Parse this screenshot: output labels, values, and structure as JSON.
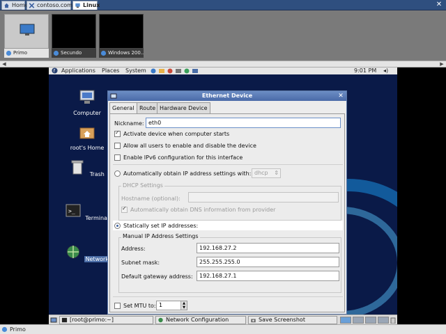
{
  "tabs": [
    {
      "label": "Home",
      "icon": "home-icon"
    },
    {
      "label": "contoso.com",
      "icon": "network-icon"
    },
    {
      "label": "Linux",
      "icon": "vm-icon",
      "active": true
    }
  ],
  "thumbnails": [
    {
      "label": "Primo",
      "active": true
    },
    {
      "label": "Secundo"
    },
    {
      "label": "Windows 200..."
    }
  ],
  "gnome_panel": {
    "menus": [
      "Applications",
      "Places",
      "System"
    ],
    "clock": "9:01 PM"
  },
  "desktop_icons": [
    {
      "label": "Computer",
      "icon": "computer-icon"
    },
    {
      "label": "root's Home",
      "icon": "home-folder-icon"
    },
    {
      "label": "Trash",
      "icon": "trash-icon"
    },
    {
      "label": "Terminal",
      "icon": "terminal-icon"
    },
    {
      "label": "Network",
      "icon": "network-config-icon",
      "selected": true
    }
  ],
  "dialog": {
    "title": "Ethernet Device",
    "tabs": [
      "General",
      "Route",
      "Hardware Device"
    ],
    "nickname_label": "Nickname:",
    "nickname_value": "eth0",
    "activate_label": "Activate device when computer starts",
    "activate_checked": true,
    "allow_users_label": "Allow all users to enable and disable the device",
    "allow_users_checked": false,
    "ipv6_label": "Enable IPv6 configuration for this interface",
    "ipv6_checked": false,
    "auto_label": "Automatically obtain IP address settings with:",
    "auto_method": "dhcp",
    "dhcp_settings_label": "DHCP Settings",
    "hostname_label": "Hostname (optional):",
    "hostname_value": "",
    "auto_dns_label": "Automatically obtain DNS information from provider",
    "auto_dns_checked": true,
    "static_label": "Statically set IP addresses:",
    "static_selected": true,
    "manual_group_label": "Manual IP Address Settings",
    "address_label": "Address:",
    "address_value": "192.168.27.2",
    "subnet_label": "Subnet mask:",
    "subnet_value": "255.255.255.0",
    "gateway_label": "Default gateway address:",
    "gateway_value": "192.168.27.1",
    "mtu_label": "Set MTU to:",
    "mtu_checked": false,
    "mtu_value": "1"
  },
  "taskbar": [
    {
      "label": "[root@primo:~]",
      "icon": "terminal-icon"
    },
    {
      "label": "Network Configuration",
      "icon": "network-config-icon"
    },
    {
      "label": "Save Screenshot",
      "icon": "camera-icon"
    }
  ],
  "workspaces": 4,
  "status": {
    "label": "Primo"
  },
  "colors": {
    "titlebar": "#5a7bb8",
    "desktop": "#0a1a48",
    "accent": "#1a8fe0"
  }
}
